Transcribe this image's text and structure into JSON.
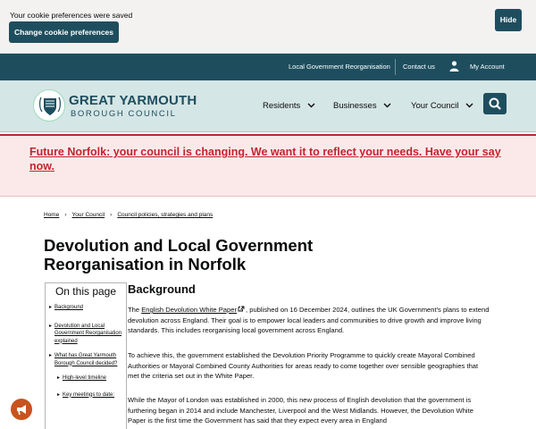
{
  "cookie": {
    "message": "Your cookie preferences were saved",
    "change_label": "Change cookie preferences",
    "hide_label": "Hide"
  },
  "utility": {
    "reorg_link": "Local Government Reorganisation",
    "contact_link": "Contact us",
    "account_link": "My Account"
  },
  "header": {
    "logo_line1": "GREAT YARMOUTH",
    "logo_line2": "BOROUGH COUNCIL",
    "nav": [
      {
        "label": "Residents"
      },
      {
        "label": "Businesses"
      },
      {
        "label": "Your Council"
      }
    ]
  },
  "alert": {
    "text": "Future Norfolk: your council is changing. We want it to reflect your needs. Have your say now."
  },
  "breadcrumb": [
    "Home",
    "Your Council",
    "Council policies, strategies and plans"
  ],
  "page_title": "Devolution and Local Government Reorganisation in Norfolk",
  "on_this_page": {
    "heading": "On this page",
    "items": [
      {
        "label": "Background"
      },
      {
        "label": "Devolution and Local Government Reorganisation explained"
      },
      {
        "label": "What has Great Yarmouth Borough Council decided?"
      },
      {
        "label": "High-level timeline"
      },
      {
        "label": "Key meetings to date:"
      }
    ]
  },
  "article": {
    "heading": "Background",
    "p1_pre": "The ",
    "p1_link": "English Devolution White Paper",
    "p1_post": ", published on 16 December 2024, outlines the UK Government's plans to extend devolution across England. Their goal is to empower local leaders and communities to drive growth and improve living standards. This includes reorganising local government across England.",
    "p2": "To achieve this, the government established the Devolution Priority Programme to quickly create Mayoral Combined Authorities or Mayoral Combined County Authorities for areas ready to come together over sensible geographies that met the criteria set out in the White Paper.",
    "p3": "While the Mayor of London was established in 2000, this new process of English devolution that the government is furthering began in 2014 and include Manchester, Liverpool and the West Midlands. However, the Devolution White Paper is the first time the Government has said that they expect every area in England"
  },
  "colors": {
    "brand": "#1e4e5e",
    "header_bg": "#d5e6e6",
    "alert_red": "#c4242d",
    "alert_bg": "#fbe9ea",
    "feedback": "#c8531c"
  },
  "icons": [
    "user-icon",
    "chevron-down-icon",
    "search-icon",
    "external-link-icon",
    "megaphone-icon",
    "crest-logo"
  ]
}
